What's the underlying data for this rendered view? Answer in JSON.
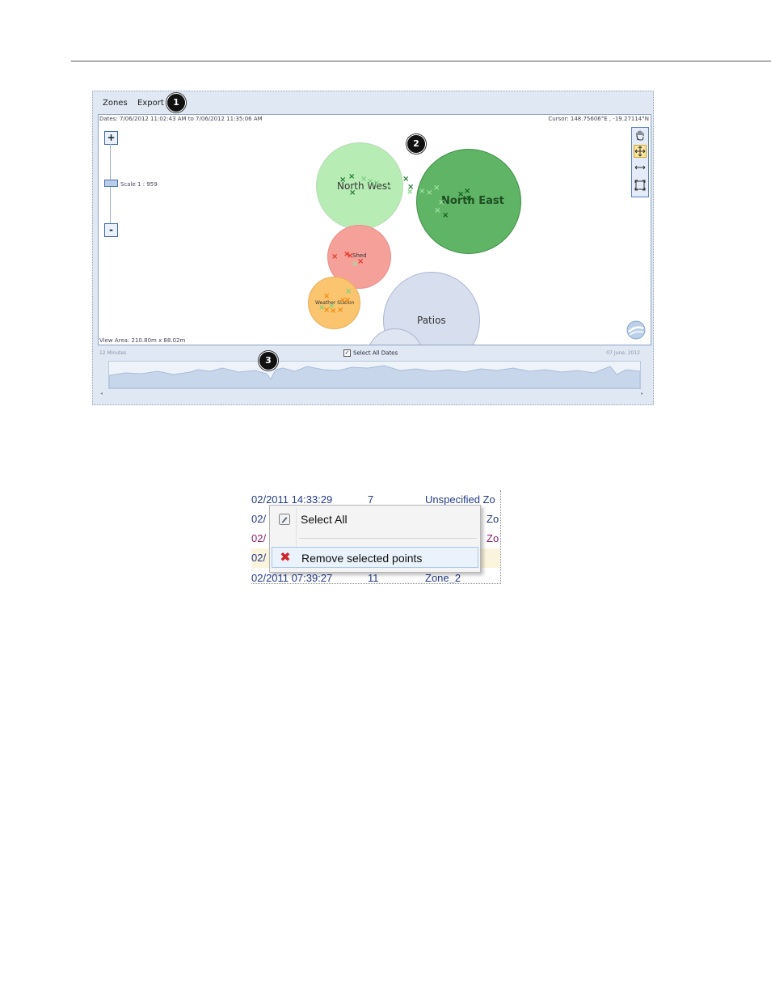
{
  "menubar": {
    "zones_label": "Zones",
    "export_label": "Export"
  },
  "callouts": [
    "1",
    "2",
    "3"
  ],
  "map": {
    "dates_text": "Dates: 7/06/2012 11:02:43 AM to 7/06/2012 11:35:06 AM",
    "cursor_text": "Cursor: 148.75606°E , -19.27114°N",
    "view_area_text": "View Area: 210.80m x 88.02m",
    "scale_text": "Scale 1 : 959",
    "zoom_in_label": "+",
    "zoom_out_label": "-",
    "zoom_level": 0.45,
    "tools": [
      "hand-icon",
      "move-icon",
      "measure-icon",
      "extent-icon"
    ],
    "active_tool": "move-icon",
    "zones": [
      {
        "name": "North West",
        "color": "#b7ecb5"
      },
      {
        "name": "North East",
        "color": "#5fb565"
      },
      {
        "name": "Shed",
        "color": "#f6a09a"
      },
      {
        "name": "Weather Station",
        "color": "#fbc46e"
      },
      {
        "name": "Patios",
        "color": "#d7deed"
      }
    ],
    "marker_glyph": "×"
  },
  "timeline": {
    "left_label": "12 Minutes",
    "right_label": "07 June, 2012",
    "select_all_label": "Select All Dates",
    "select_all_checked": true,
    "check_glyph": "✓",
    "left_arrow": "◂",
    "right_arrow": "▸"
  },
  "context_shot": {
    "rows": [
      {
        "date": "02/2011 14:33:29",
        "num": "7",
        "zone": "Unspecified Zo"
      },
      {
        "date": "02/",
        "num": "",
        "zone": "Zo"
      },
      {
        "date": "02/",
        "num": "",
        "zone": "Zo"
      },
      {
        "date": "02/",
        "num": "",
        "zone": ""
      },
      {
        "date": "02/2011 07:39:27",
        "num": "11",
        "zone": "Zone_2"
      }
    ],
    "menu": {
      "select_all_label": "Select All",
      "remove_label": "Remove selected points",
      "remove_icon_glyph": "✖",
      "select_icon_glyph": "✎"
    }
  }
}
